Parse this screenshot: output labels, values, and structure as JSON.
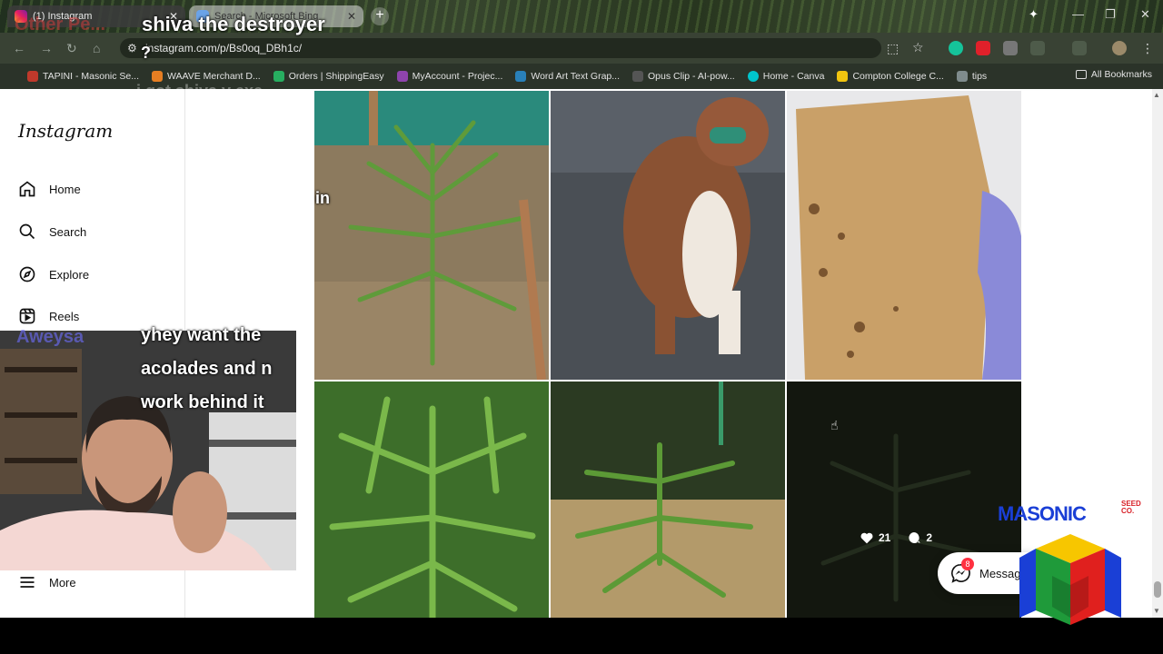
{
  "browser": {
    "tabs": [
      {
        "title": "(1) Instagram",
        "active": true
      },
      {
        "title": "Search - Microsoft Bing",
        "active": false
      }
    ],
    "url": "instagram.com/p/Bs0oq_DBh1c/",
    "bookmarks": [
      {
        "label": "TAPINI - Masonic Se...",
        "color": "#c0392b"
      },
      {
        "label": "WAAVE Merchant D...",
        "color": "#e67e22"
      },
      {
        "label": "Orders | ShippingEasy",
        "color": "#27ae60"
      },
      {
        "label": "MyAccount - Projec...",
        "color": "#8e44ad"
      },
      {
        "label": "Word Art Text Grap...",
        "color": "#2980b9"
      },
      {
        "label": "Opus Clip - AI-pow...",
        "color": "#555555"
      },
      {
        "label": "Home - Canva",
        "color": "#00c4cc"
      },
      {
        "label": "Compton College C...",
        "color": "#f1c40f"
      },
      {
        "label": "tips",
        "color": "#7f8c8d"
      }
    ],
    "all_bookmarks": "All Bookmarks"
  },
  "instagram": {
    "logo": "Instagram",
    "nav": {
      "home": "Home",
      "search": "Search",
      "explore": "Explore",
      "reels": "Reels",
      "more": "More"
    },
    "hover_stats": {
      "likes": "21",
      "comments": "2"
    },
    "messages": {
      "label": "Messag",
      "badge": "8"
    }
  },
  "overlay": {
    "title": "shiva the destroyer",
    "title_faded": "Other Pe...",
    "question": "?",
    "chat_faded": "i got shiva v exe",
    "side_fragment": "in",
    "chat_line_1": "yhey want the",
    "chat_line_2": "acolades and n",
    "chat_line_3": "work behind it",
    "chat_user": "Aweysa",
    "brand": "MASONIC",
    "brand_sub_1": "SEED",
    "brand_sub_2": "CO."
  },
  "colors": {
    "brand_blue": "#1a3fd6",
    "brand_red": "#d81f26",
    "badge_red": "#ff3040"
  }
}
